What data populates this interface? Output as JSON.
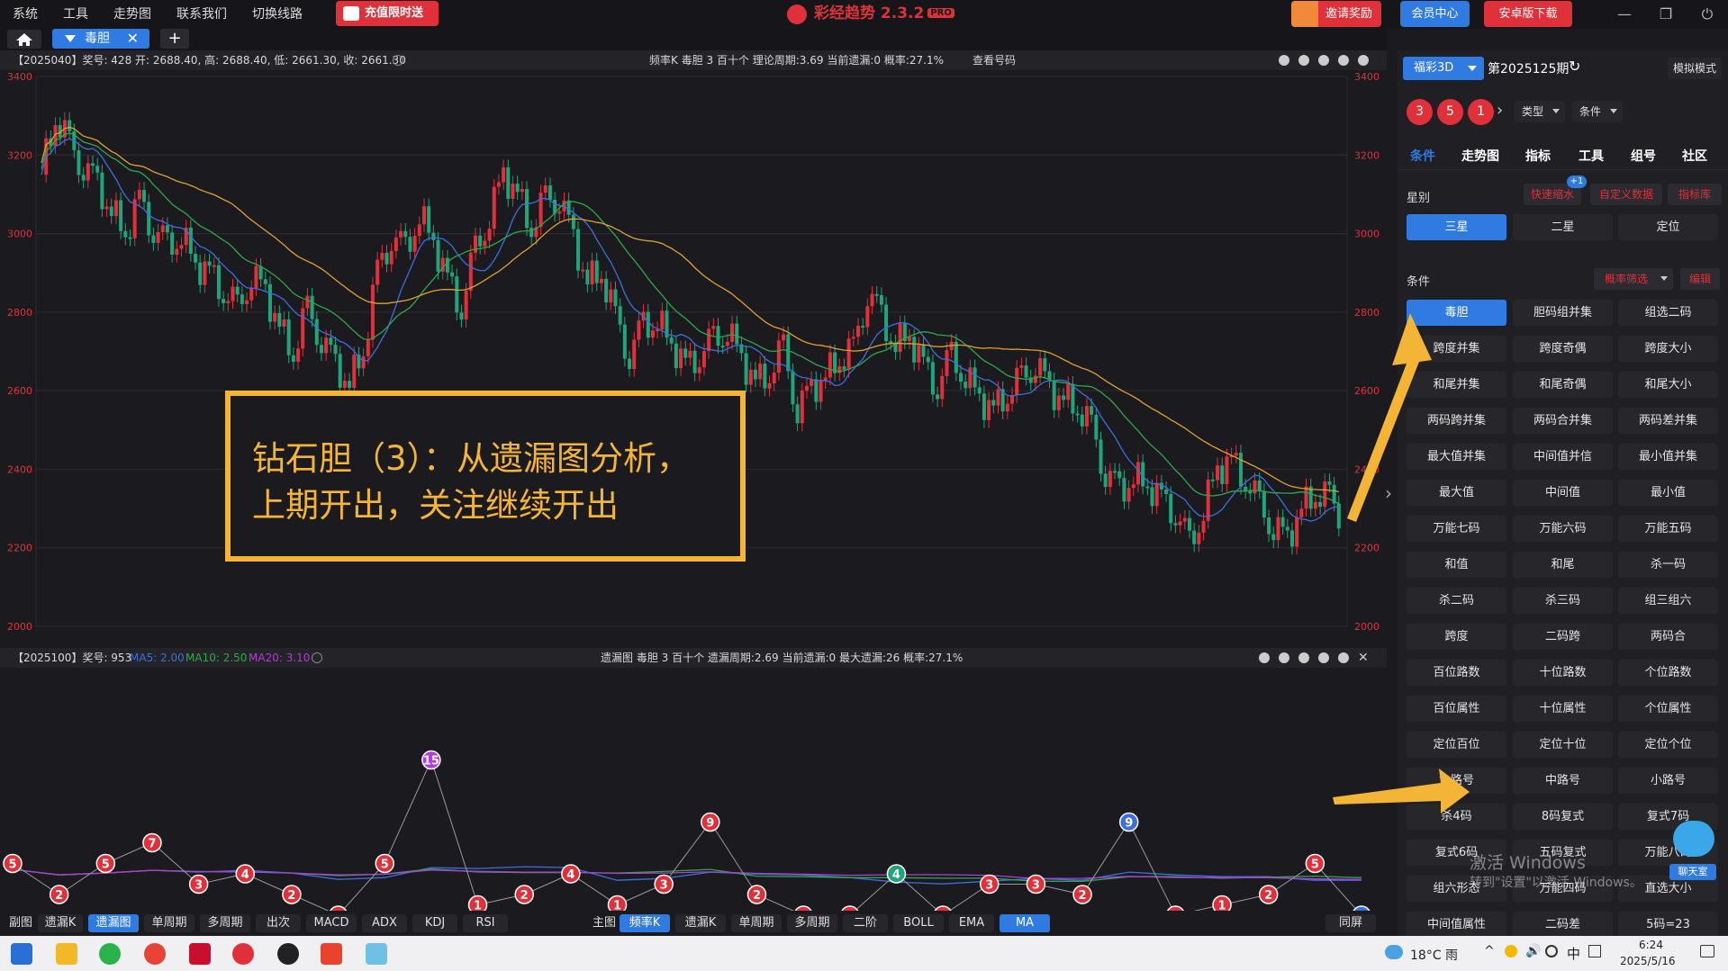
{
  "menu": [
    "系统",
    "工具",
    "走势图",
    "联系我们",
    "切换线路"
  ],
  "recharge_label": "充值限时送",
  "app_title": "彩经趋势 2.3.2",
  "app_badge": "PRO",
  "invite_label": "邀请奖励",
  "member_label": "会员中心",
  "android_label": "安卓版下载",
  "tab_label": "毒胆",
  "tab_add": "+",
  "pane1": {
    "left_info": "【2025040】奖号: 428  开: 2688.40, 高: 2688.40, 低: 2661.30, 收: 2661.30",
    "center_info": "频率K  毒胆  3  百十个  理论周期:3.69  当前遗漏:0  概率:27.1%",
    "query_label": "查看号码",
    "y_ticks": [
      "3400",
      "3200",
      "3000",
      "2800",
      "2600",
      "2400",
      "2200",
      "2000"
    ]
  },
  "pane2": {
    "left_info_prefix": "【2025100】奖号: 953",
    "ma5": "MA5: 2.00",
    "ma10": "MA10: 2.50",
    "ma20": "MA20: 3.10",
    "center_info": "遗漏图  毒胆  3  百十个  遗漏周期:2.69  当前遗漏:0  最大遗漏:26  概率:27.1%"
  },
  "annotation": {
    "line1": "钻石胆（3）：从遗漏图分析，",
    "line2": "上期开出，关注继续开出"
  },
  "bottom_left": {
    "label": "副图",
    "buttons": [
      "遗漏K",
      "遗漏图",
      "单周期",
      "多周期",
      "出次",
      "MACD",
      "ADX",
      "KDJ",
      "RSI"
    ],
    "active": "遗漏图"
  },
  "bottom_right": {
    "label": "主图",
    "buttons": [
      "频率K",
      "遗漏K",
      "单周期",
      "多周期",
      "二阶",
      "BOLL",
      "EMA",
      "MA"
    ],
    "active": [
      "频率K",
      "MA"
    ]
  },
  "same_screen": "同屏",
  "right_panel": {
    "lottery_select": "福彩3D",
    "period": "第2025125期",
    "mode_btn": "模拟模式",
    "balls": [
      "3",
      "5",
      "1"
    ],
    "type_select": "类型",
    "cond_select": "条件",
    "tabs": [
      "条件",
      "走势图",
      "指标",
      "工具",
      "组号",
      "社区"
    ],
    "star_label": "星别",
    "quick_links": [
      "快速缩水",
      "自定义数据",
      "指标库"
    ],
    "quick_badge": "+1",
    "star_btns": [
      "三星",
      "二星",
      "定位"
    ],
    "cond_label": "条件",
    "prob_filter": "概率筛选",
    "edit": "编辑",
    "grid": [
      [
        "毒胆",
        "胆码组并集",
        "组选二码"
      ],
      [
        "跨度并集",
        "跨度奇偶",
        "跨度大小"
      ],
      [
        "和尾并集",
        "和尾奇偶",
        "和尾大小"
      ],
      [
        "两码跨并集",
        "两码合并集",
        "两码差并集"
      ],
      [
        "最大值并集",
        "中间值并信",
        "最小值并集"
      ],
      [
        "最大值",
        "中间值",
        "最小值"
      ],
      [
        "万能七码",
        "万能六码",
        "万能五码"
      ],
      [
        "和值",
        "和尾",
        "杀一码"
      ],
      [
        "杀二码",
        "杀三码",
        "组三组六"
      ],
      [
        "跨度",
        "二码跨",
        "两码合"
      ],
      [
        "百位路数",
        "十位路数",
        "个位路数"
      ],
      [
        "百位属性",
        "十位属性",
        "个位属性"
      ],
      [
        "定位百位",
        "定位十位",
        "定位个位"
      ],
      [
        "大路号",
        "中路号",
        "小路号"
      ],
      [
        "杀4码",
        "8码复式",
        "复式7码"
      ],
      [
        "复式6码",
        "五码复式",
        "万能八码"
      ],
      [
        "组六形态",
        "万能四码",
        "直选大小"
      ],
      [
        "中间值属性",
        "二码差",
        "5码=23"
      ]
    ],
    "chat_label": "聊天室",
    "watermark1": "激活 Windows",
    "watermark2": "转到\"设置\"以激活 Windows。"
  },
  "taskbar": {
    "weather": "18°C 雨",
    "ime": "中",
    "time": "6:24",
    "date": "2025/5/16"
  },
  "colors": {
    "accent": "#2f7be2",
    "red": "#e0313a",
    "annotation": "#f4b436",
    "up_candle": "#e0313a",
    "down_candle": "#1fa57a",
    "ma_blue": "#3b6fe0",
    "ma_green": "#2ea84a",
    "ma_orange": "#e0a030"
  },
  "chart_data": [
    {
      "type": "candlestick",
      "title": "频率K 毒胆 3 百十个",
      "ylim": [
        2000,
        3400
      ],
      "y_ticks": [
        3400,
        3200,
        3000,
        2800,
        2600,
        2400,
        2200,
        2000
      ],
      "close": [
        3150,
        3300,
        3220,
        3180,
        3120,
        3060,
        3000,
        3080,
        3020,
        2960,
        3000,
        2920,
        2900,
        2860,
        2800,
        2900,
        2850,
        2760,
        2700,
        2800,
        2740,
        2660,
        2620,
        2700,
        2900,
        3000,
        2950,
        3050,
        2980,
        2880,
        2820,
        2950,
        3050,
        3150,
        3100,
        3020,
        3080,
        3100,
        2980,
        2880,
        2900,
        2780,
        2700,
        2760,
        2780,
        2720,
        2660,
        2700,
        2720,
        2760,
        2680,
        2620,
        2650,
        2700,
        2560,
        2600,
        2640,
        2680,
        2700,
        2860,
        2780,
        2720,
        2740,
        2660,
        2620,
        2680,
        2640,
        2580,
        2550,
        2600,
        2620,
        2680,
        2600,
        2580,
        2560,
        2500,
        2400,
        2340,
        2380,
        2360,
        2320,
        2300,
        2200,
        2300,
        2400,
        2420,
        2380,
        2300,
        2260,
        2220,
        2300,
        2340,
        2320,
        2280
      ],
      "series": [
        {
          "name": "MA5",
          "color": "#3b6fe0"
        },
        {
          "name": "MA10",
          "color": "#2ea84a"
        },
        {
          "name": "MA20",
          "color": "#e0a030"
        }
      ]
    },
    {
      "type": "line",
      "title": "遗漏图 毒胆 3 百十个",
      "values": [
        5,
        2,
        5,
        7,
        3,
        4,
        2,
        0,
        5,
        15,
        1,
        2,
        4,
        1,
        3,
        9,
        2,
        0,
        0,
        4,
        0,
        3,
        3,
        2,
        9,
        0,
        1,
        2,
        5,
        0
      ]
    }
  ]
}
